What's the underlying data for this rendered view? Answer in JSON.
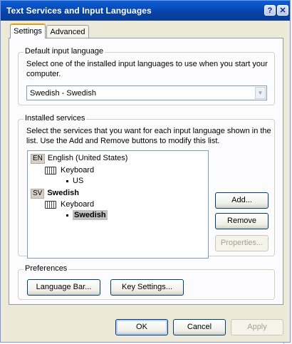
{
  "window": {
    "title": "Text Services and Input Languages",
    "help_glyph": "?",
    "close_glyph": "✕"
  },
  "tabs": [
    {
      "label": "Settings",
      "active": true
    },
    {
      "label": "Advanced",
      "active": false
    }
  ],
  "default_input_language": {
    "legend": "Default input language",
    "description": "Select one of the installed input languages to use when you start your computer.",
    "selected": "Swedish - Swedish"
  },
  "installed_services": {
    "legend": "Installed services",
    "description": "Select the services that you want for each input language shown in the list. Use the Add and Remove buttons to modify this list.",
    "languages": [
      {
        "code": "EN",
        "name": "English (United States)",
        "category": "Keyboard",
        "layout": "US",
        "selected": false
      },
      {
        "code": "SV",
        "name": "Swedish",
        "category": "Keyboard",
        "layout": "Swedish",
        "selected": true
      }
    ],
    "buttons": {
      "add": "Add...",
      "remove": "Remove",
      "properties": "Properties..."
    }
  },
  "preferences": {
    "legend": "Preferences",
    "language_bar": "Language Bar...",
    "key_settings": "Key Settings..."
  },
  "footer": {
    "ok": "OK",
    "cancel": "Cancel",
    "apply": "Apply"
  },
  "colors": {
    "title_bar": "#0842a8",
    "dialog_face": "#ece9d8",
    "tab_highlight": "#e6a000",
    "button_border": "#003c74"
  }
}
